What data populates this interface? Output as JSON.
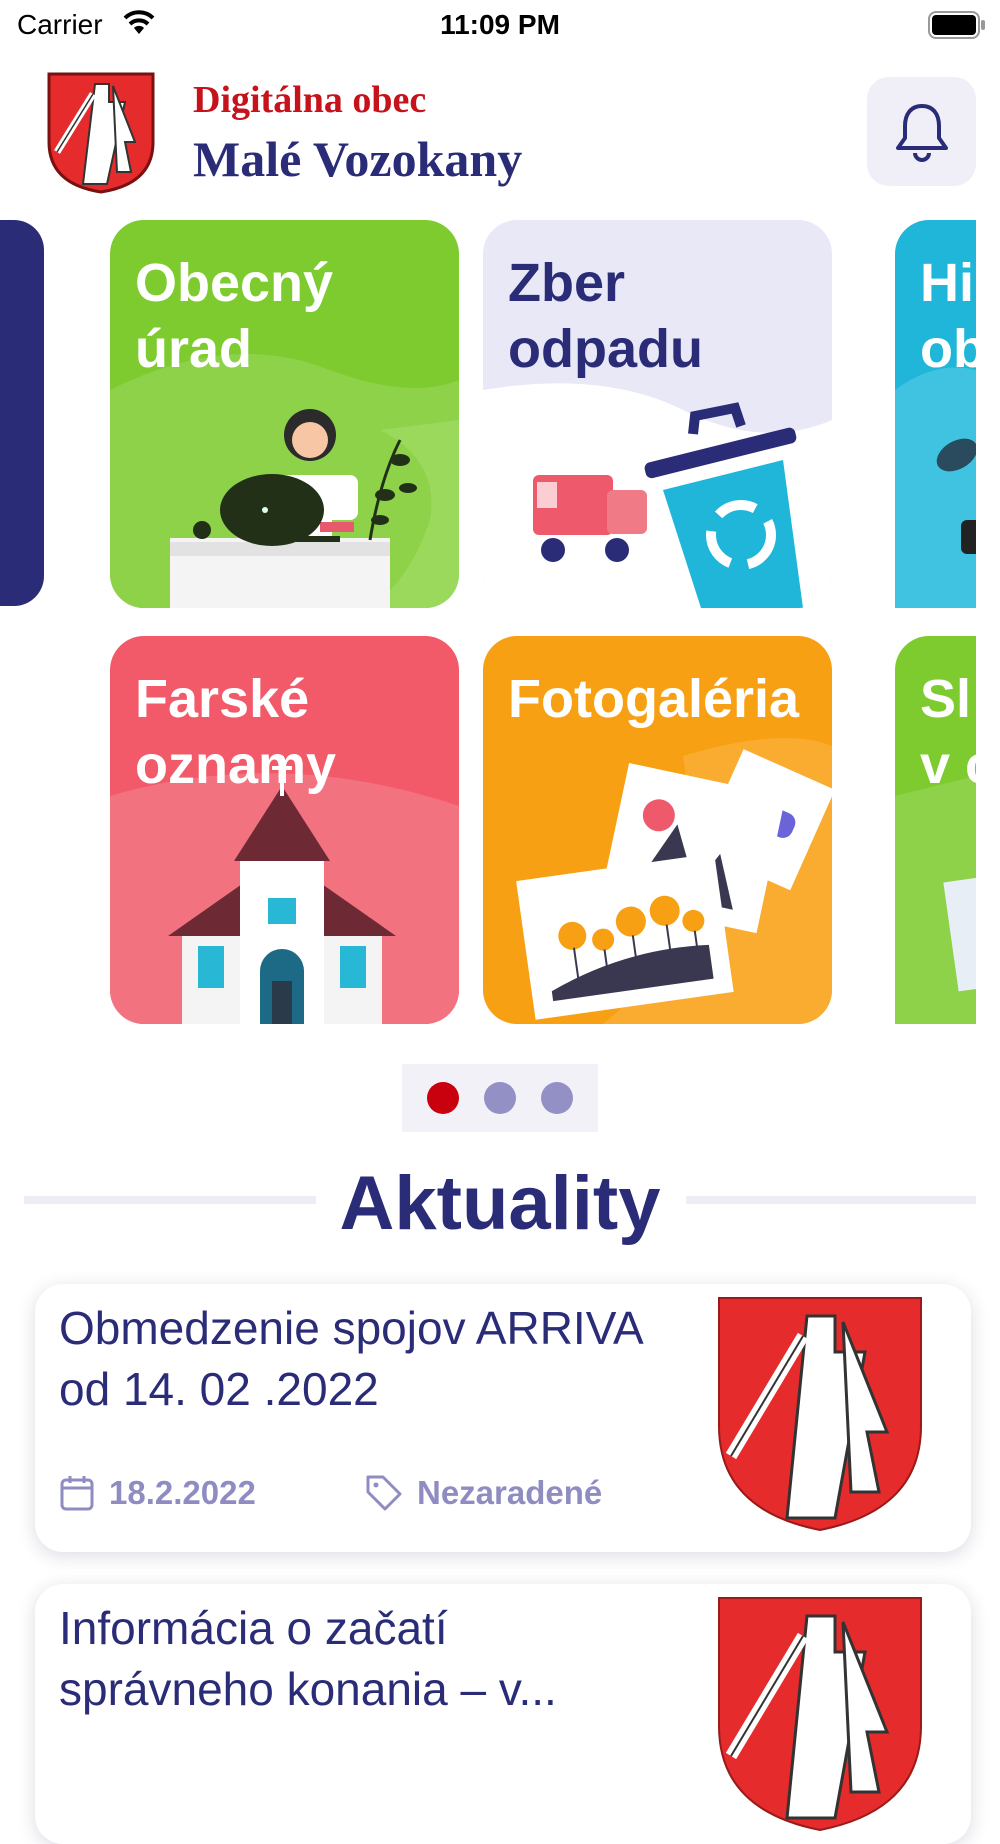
{
  "status_bar": {
    "carrier": "Carrier",
    "time": "11:09 PM"
  },
  "header": {
    "subtitle": "Digitálna obec",
    "title": "Malé Vozokany"
  },
  "tiles": [
    {
      "label": "Obecný\núrad",
      "color": "#7dcb2e"
    },
    {
      "label": "Zber\nodpadu",
      "color": "#e9e8f6"
    },
    {
      "label": "Farské\noznamy",
      "color": "#f25a6a"
    },
    {
      "label": "Fotogaléria",
      "color": "#f7a013"
    }
  ],
  "edge_tiles": [
    {
      "label": "Hi\nob",
      "color": "#1fb6d9"
    },
    {
      "label": "Sl\nv c",
      "color": "#7dcb2e"
    }
  ],
  "pager": {
    "pages": 3,
    "active": 1
  },
  "section": {
    "title": "Aktuality"
  },
  "news": [
    {
      "title": "Obmedzenie spojov ARRIVA od 14. 02 .2022",
      "date": "18.2.2022",
      "category": "Nezaradené"
    },
    {
      "title": "Informácia o začatí správneho konania – v..."
    }
  ],
  "colors": {
    "brand_red": "#c5121b",
    "navy": "#2a2c78",
    "dot_active": "#c9000e",
    "dot_inactive": "#9390c6"
  },
  "icons": [
    "wifi-icon",
    "battery-icon",
    "bell-icon",
    "calendar-icon",
    "tag-icon",
    "coat-of-arms"
  ]
}
